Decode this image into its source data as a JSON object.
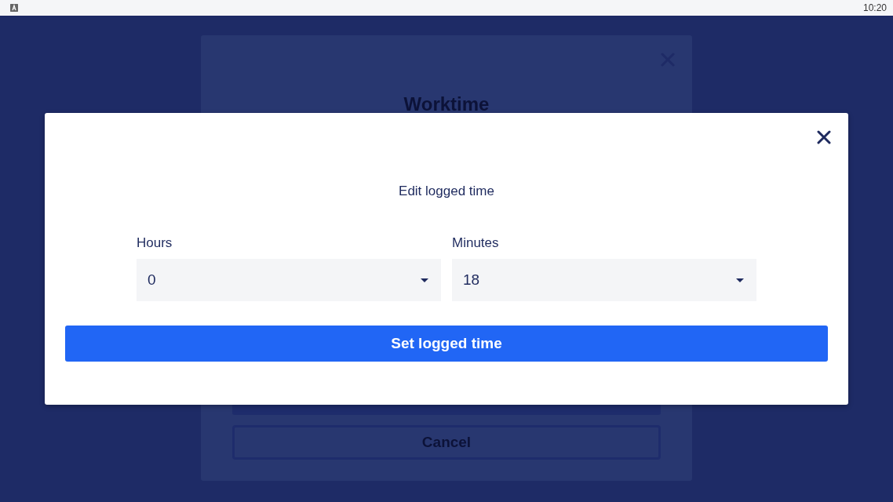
{
  "status_bar": {
    "time": "10:20"
  },
  "background_dialog": {
    "title": "Worktime",
    "cancel_button": "Cancel"
  },
  "dialog": {
    "title": "Edit logged time",
    "fields": [
      {
        "label": "Hours",
        "value": "0"
      },
      {
        "label": "Minutes",
        "value": "18"
      }
    ],
    "button": "Set logged time"
  }
}
